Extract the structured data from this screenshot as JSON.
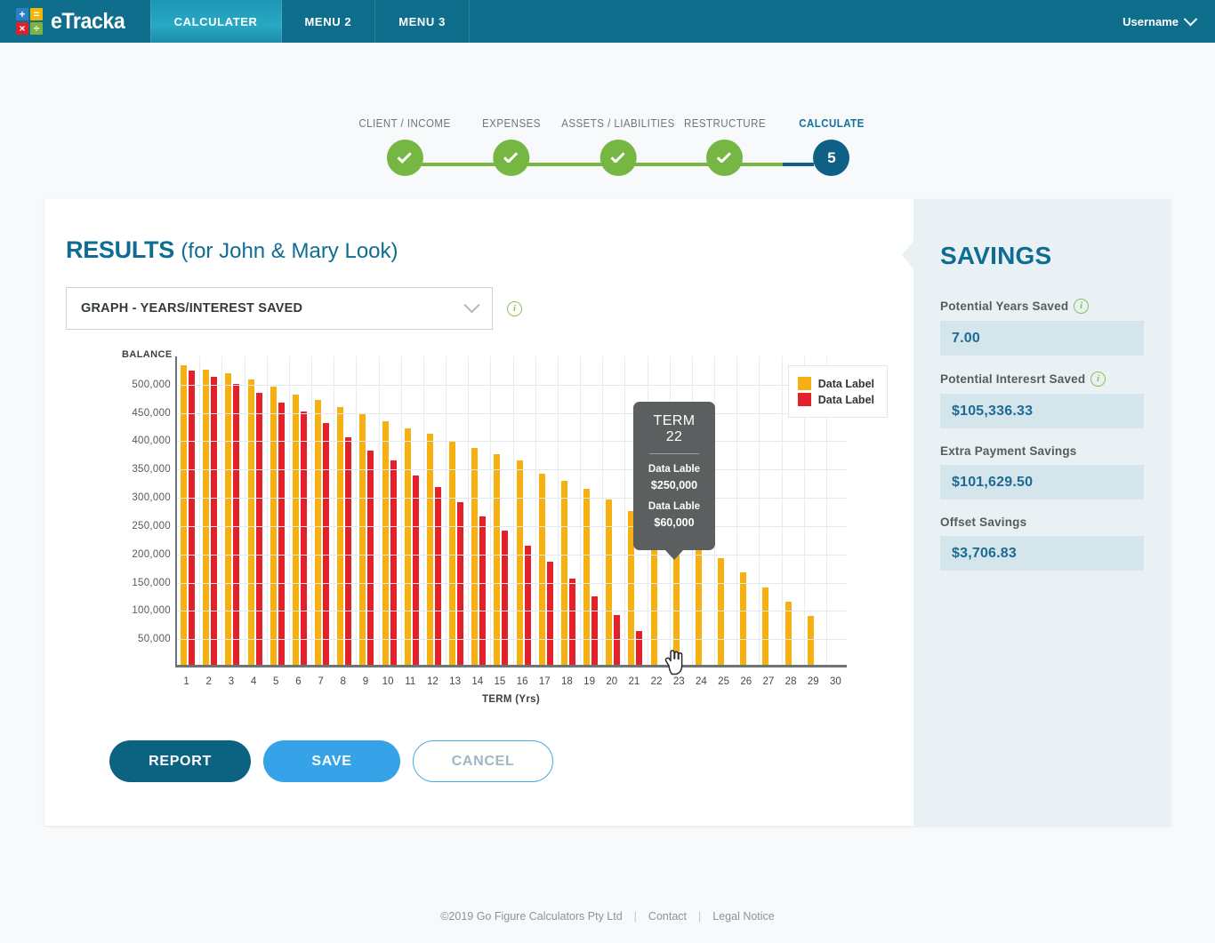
{
  "topnav": {
    "brand": "eTracka",
    "logo_cells": [
      {
        "icon": "plus-icon",
        "glyph": "+",
        "color": "#2b7fc4"
      },
      {
        "icon": "equals-icon",
        "glyph": "=",
        "color": "#f2b705"
      },
      {
        "icon": "multiply-icon",
        "glyph": "×",
        "color": "#dd2128"
      },
      {
        "icon": "divide-icon",
        "glyph": "÷",
        "color": "#7cb342"
      }
    ],
    "items": [
      {
        "label": "CALCULATER",
        "active": true
      },
      {
        "label": "MENU 2",
        "active": false
      },
      {
        "label": "MENU 3",
        "active": false
      }
    ],
    "user": "Username",
    "bar_color": "#0e6e8c",
    "active_color": "#27a9c4"
  },
  "stepper": {
    "steps": [
      {
        "label": "CLIENT / INCOME",
        "state": "done"
      },
      {
        "label": "EXPENSES",
        "state": "done"
      },
      {
        "label": "ASSETS / LIABILITIES",
        "state": "done"
      },
      {
        "label": "RESTRUCTURE",
        "state": "done"
      },
      {
        "label": "CALCULATE",
        "state": "current",
        "number": "5"
      }
    ],
    "done_color": "#76b743",
    "current_color": "#0f5f86"
  },
  "results": {
    "title_bold": "RESULTS",
    "title_rest": "(for John & Mary Look)",
    "graph_select": {
      "value": "GRAPH - YEARS/INTEREST SAVED",
      "options": [
        "GRAPH - YEARS/INTEREST SAVED"
      ]
    },
    "info_glyph": "i"
  },
  "buttons": {
    "report": "REPORT",
    "save": "SAVE",
    "cancel": "CANCEL"
  },
  "savings": {
    "title": "SAVINGS",
    "fields": [
      {
        "label": "Potential Years Saved",
        "value": "7.00",
        "info": true
      },
      {
        "label": "Potential Interesrt Saved",
        "value": "$105,336.33",
        "info": true
      },
      {
        "label": "Extra Payment Savings",
        "value": "$101,629.50",
        "info": false
      },
      {
        "label": "Offset Savings",
        "value": "$3,706.83",
        "info": false
      }
    ],
    "accent": "#1b6b93",
    "field_bg": "#d5e5ec"
  },
  "tooltip": {
    "title": "TERM 22",
    "rows": [
      {
        "label": "Data Lable",
        "value": "$250,000"
      },
      {
        "label": "Data Lable",
        "value": "$60,000"
      }
    ]
  },
  "footer": {
    "copyright": "©2019 Go Figure Calculators Pty Ltd",
    "sep": "|",
    "contact": "Contact",
    "legal": "Legal Notice"
  },
  "chart_data": {
    "type": "bar",
    "title": "",
    "xlabel": "TERM (Yrs)",
    "ylabel": "BALANCE",
    "ylim": [
      0,
      550000
    ],
    "ytick_values": [
      50000,
      100000,
      150000,
      200000,
      250000,
      300000,
      350000,
      400000,
      450000,
      500000
    ],
    "ytick_labels": [
      "50,000",
      "100,000",
      "150,000",
      "200,000",
      "250,000",
      "300,000",
      "350,000",
      "400,000",
      "450,000",
      "500,000"
    ],
    "grid": true,
    "legend_position": "top-right",
    "categories": [
      1,
      2,
      3,
      4,
      5,
      6,
      7,
      8,
      9,
      10,
      11,
      12,
      13,
      14,
      15,
      16,
      17,
      18,
      19,
      20,
      21,
      22,
      23,
      24,
      25,
      26,
      27,
      28,
      29,
      30
    ],
    "series": [
      {
        "name": "Data Label",
        "color": "#f6b011",
        "values": [
          530000,
          522000,
          515000,
          505000,
          492000,
          478000,
          468000,
          455000,
          444000,
          430000,
          418000,
          408000,
          394000,
          384000,
          373000,
          362000,
          338000,
          325000,
          311000,
          292000,
          272000,
          250000,
          227000,
          205000,
          188000,
          163000,
          137000,
          112000,
          86000,
          0
        ]
      },
      {
        "name": "Data Label",
        "color": "#e3212b",
        "values": [
          520000,
          509000,
          497000,
          481000,
          463000,
          448000,
          427000,
          403000,
          378000,
          361000,
          335000,
          315000,
          288000,
          262000,
          237000,
          210000,
          182000,
          152000,
          121000,
          88000,
          60000,
          0,
          0,
          0,
          0,
          0,
          0,
          0,
          0,
          0
        ]
      }
    ]
  }
}
